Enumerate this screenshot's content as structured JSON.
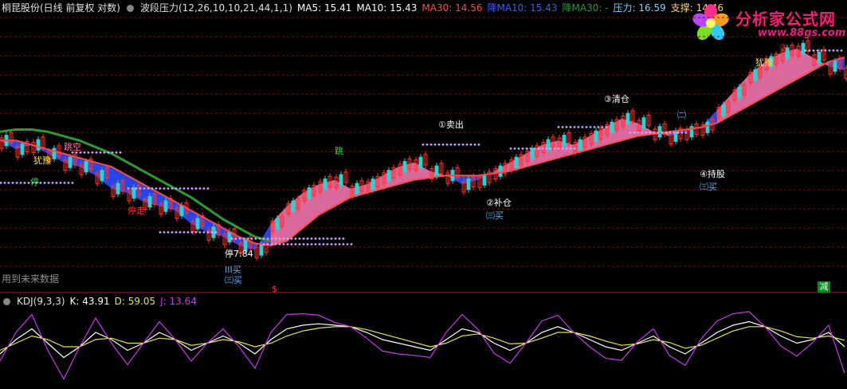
{
  "header": {
    "stock": "桐昆股份(日线 前复权 对数)",
    "indicator": "波段压力(12,26,10,10,21,44,1,1)",
    "ma5": "MA5: 15.41",
    "ma10": "MA10: 15.43",
    "ma30": "MA30: 14.56",
    "down_ma10": "降MA10: 15.43",
    "down_ma30": "降MA30: -",
    "pressure": "压力: 16.59",
    "support": "支撑: 14.46"
  },
  "kdj_header": {
    "name": "KDJ(9,3,3)",
    "k": "K: 43.91",
    "d": "D: 59.05",
    "j": "J: 13.64"
  },
  "logo": {
    "title": "分析家公式网",
    "url": "www.88gs.com"
  },
  "notes": {
    "future": "用到未来数据",
    "reduce": "减",
    "dollar": "$"
  },
  "colors": {
    "ma30_line": "#ff4a4a",
    "green_line": "#2e9b2e",
    "pink_band": "#ff7ab8",
    "blue_band": "#2a4cff",
    "k_line": "#ffffff",
    "d_line": "#e8e24a",
    "j_line": "#c639e8",
    "grid": "#7a1010"
  },
  "chart_data": [
    {
      "type": "line",
      "name": "price-panel",
      "x": [
        0,
        20,
        40,
        60,
        80,
        100,
        120,
        140,
        160,
        180,
        200,
        220,
        240,
        260,
        280,
        300,
        320,
        340,
        360,
        380,
        400,
        420,
        440,
        460,
        480,
        500,
        520,
        540,
        560,
        580,
        600,
        620,
        640,
        660,
        680,
        700,
        720,
        740,
        760,
        780,
        800,
        820,
        840,
        860,
        880,
        900,
        920,
        940,
        960,
        980,
        1000,
        1020,
        1040,
        1060
      ],
      "series": [
        {
          "values": [
            15.1,
            15.1,
            15.0,
            14.9,
            14.8,
            14.7,
            14.6,
            14.5,
            14.3,
            14.1,
            13.9,
            13.7,
            13.5,
            13.3,
            13.1,
            12.9,
            12.75,
            12.7,
            12.8,
            13.1,
            13.4,
            13.6,
            13.8,
            13.9,
            14.0,
            14.1,
            14.2,
            14.25,
            14.3,
            14.3,
            14.3,
            14.35,
            14.4,
            14.5,
            14.6,
            14.7,
            14.8,
            14.9,
            15.0,
            15.1,
            15.2,
            15.25,
            15.3,
            15.35,
            15.4,
            15.5,
            15.7,
            15.9,
            16.1,
            16.3,
            16.5,
            16.7,
            16.9,
            17.0
          ]
        },
        {
          "values": [
            15.3,
            15.35,
            15.35,
            15.3,
            15.2,
            15.1,
            14.95,
            14.8,
            14.6,
            14.4,
            14.2,
            14.0,
            13.8,
            13.55,
            13.3,
            13.1,
            12.9,
            12.8
          ]
        },
        {
          "values": [
            15.1,
            14.9,
            15.0,
            14.8,
            14.6,
            14.5,
            14.3,
            14.0,
            13.9,
            13.7,
            13.6,
            13.5,
            13.2,
            13.0,
            12.9,
            12.7,
            12.6,
            13.2,
            13.6,
            13.9,
            14.1,
            14.2,
            14.0,
            14.1,
            14.3,
            14.5,
            14.6,
            14.4,
            14.3,
            14.1,
            14.2,
            14.4,
            14.6,
            14.8,
            15.0,
            15.1,
            15.0,
            15.2,
            15.4,
            15.6,
            15.5,
            15.3,
            15.2,
            15.3,
            15.4,
            15.8,
            16.2,
            16.6,
            16.9,
            17.1,
            17.2,
            17.0,
            16.8,
            16.7
          ]
        }
      ],
      "annotations": [
        "跳空",
        "犹豫",
        "停",
        "停走",
        "跳",
        "①卖出",
        "②补仓",
        "㈢买",
        "③清仓",
        "㈡",
        "④持股",
        "㈢买",
        "停7:84",
        "III买",
        "㈢买",
        "犹豫",
        "③"
      ]
    },
    {
      "type": "line",
      "name": "kdj-panel",
      "x": [
        0,
        20,
        40,
        60,
        80,
        100,
        120,
        140,
        160,
        180,
        200,
        220,
        240,
        260,
        280,
        300,
        320,
        340,
        360,
        380,
        400,
        420,
        440,
        460,
        480,
        500,
        520,
        540,
        560,
        580,
        600,
        620,
        640,
        660,
        680,
        700,
        720,
        740,
        760,
        780,
        800,
        820,
        840,
        860,
        880,
        900,
        920,
        940,
        960,
        980,
        1000,
        1020,
        1040,
        1060
      ],
      "ylim": [
        0,
        100
      ],
      "series": [
        {
          "name": "K",
          "values": [
            40,
            60,
            75,
            55,
            35,
            50,
            70,
            60,
            45,
            55,
            70,
            60,
            45,
            55,
            65,
            55,
            40,
            60,
            75,
            80,
            82,
            80,
            78,
            70,
            60,
            55,
            50,
            45,
            60,
            75,
            70,
            55,
            45,
            55,
            70,
            78,
            70,
            60,
            50,
            45,
            55,
            65,
            50,
            40,
            55,
            70,
            80,
            85,
            78,
            65,
            55,
            60,
            70,
            50
          ]
        },
        {
          "name": "D",
          "values": [
            45,
            55,
            65,
            60,
            50,
            50,
            60,
            62,
            55,
            55,
            62,
            60,
            52,
            55,
            60,
            57,
            50,
            55,
            65,
            72,
            76,
            78,
            78,
            74,
            68,
            62,
            56,
            50,
            55,
            65,
            68,
            62,
            54,
            55,
            62,
            70,
            70,
            65,
            58,
            52,
            54,
            60,
            56,
            48,
            52,
            62,
            72,
            78,
            78,
            72,
            64,
            62,
            65,
            59
          ]
        },
        {
          "name": "J",
          "values": [
            30,
            70,
            95,
            45,
            5,
            50,
            90,
            55,
            25,
            55,
            85,
            60,
            30,
            55,
            75,
            50,
            20,
            70,
            95,
            96,
            94,
            84,
            78,
            62,
            44,
            40,
            38,
            35,
            70,
            95,
            74,
            41,
            27,
            55,
            86,
            94,
            70,
            50,
            34,
            31,
            57,
            75,
            38,
            24,
            61,
            86,
            96,
            99,
            78,
            51,
            37,
            56,
            80,
            13
          ]
        }
      ]
    }
  ]
}
